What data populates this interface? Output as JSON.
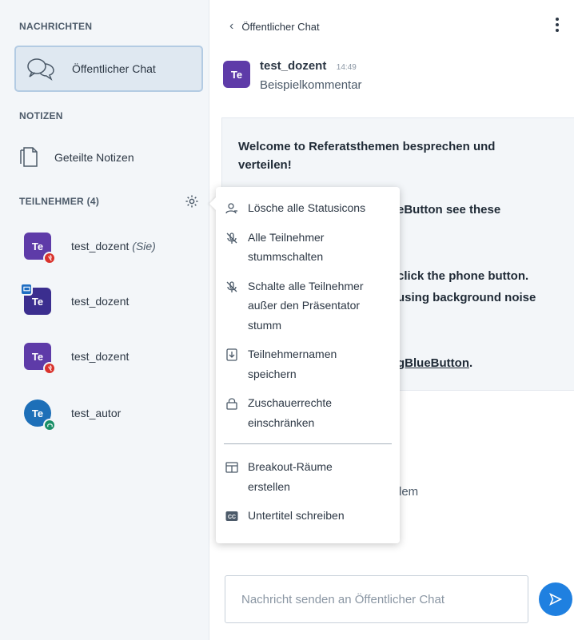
{
  "sidebar": {
    "messages_label": "NACHRICHTEN",
    "public_chat_label": "Öffentlicher Chat",
    "notes_label": "NOTIZEN",
    "shared_notes_label": "Geteilte Notizen",
    "participants_label": "TEILNEHMER (4)",
    "participants": [
      {
        "initials": "Te",
        "name": "test_dozent",
        "suffix": "(Sie)",
        "status": "muted"
      },
      {
        "initials": "Te",
        "name": "test_dozent",
        "suffix": "",
        "status": "presenter"
      },
      {
        "initials": "Te",
        "name": "test_dozent",
        "suffix": "",
        "status": "muted"
      },
      {
        "initials": "Te",
        "name": "test_autor",
        "suffix": "",
        "status": "listen-only"
      }
    ]
  },
  "chat": {
    "header_title": "Öffentlicher Chat",
    "message": {
      "initials": "Te",
      "author": "test_dozent",
      "time": "14:49",
      "text": "Beispielkommentar"
    },
    "welcome": {
      "line1": "Welcome to Referatsthemen besprechen und",
      "line2": "verteilen!",
      "frag1": "eButton see these",
      "frag2": "click the phone button.",
      "frag3": "using background noise",
      "frag4_link": "gBlueButton",
      "frag4_tail": "."
    },
    "partial_text": "lem",
    "composer_placeholder": "Nachricht senden an Öffentlicher Chat"
  },
  "menu": {
    "items": [
      {
        "icon": "user-clear-icon",
        "label_lines": [
          "Lösche alle Statusicons"
        ]
      },
      {
        "icon": "mute-icon",
        "label_lines": [
          "Alle Teilnehmer",
          "stummschalten"
        ]
      },
      {
        "icon": "mute-except-icon",
        "label_lines": [
          "Schalte alle Teilnehmer",
          "außer den Präsentator",
          "stumm"
        ]
      },
      {
        "icon": "download-icon",
        "label_lines": [
          "Teilnehmernamen",
          "speichern"
        ]
      },
      {
        "icon": "lock-icon",
        "label_lines": [
          "Zuschauerrechte",
          "einschränken"
        ]
      },
      {
        "icon": "breakout-icon",
        "label_lines": [
          "Breakout-Räume",
          "erstellen"
        ]
      },
      {
        "icon": "closed-caption-icon",
        "label_lines": [
          "Untertitel schreiben"
        ]
      }
    ]
  },
  "colors": {
    "accent": "#1f80e0",
    "avatar_purple": "#5e3ba8",
    "avatar_blue": "#1d6fb8",
    "muted_red": "#d9322c",
    "listen_green": "#1a8f68"
  }
}
